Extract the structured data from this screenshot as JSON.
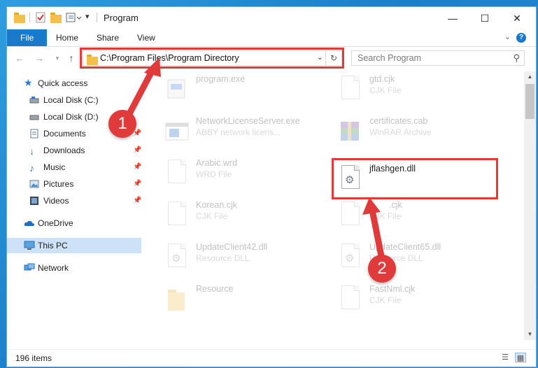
{
  "window": {
    "title": "Program",
    "controls": {
      "minimize": "—",
      "maximize": "☐",
      "close": "✕"
    }
  },
  "ribbon": {
    "tabs": [
      {
        "label": "File"
      },
      {
        "label": "Home"
      },
      {
        "label": "Share"
      },
      {
        "label": "View"
      }
    ],
    "help": "?"
  },
  "navigation": {
    "address": "C:\\Program Files\\Program Directory",
    "search_placeholder": "Search Program"
  },
  "sidebar": {
    "items": [
      {
        "label": "Quick access",
        "icon": "star-icon",
        "pinned": false
      },
      {
        "label": "Local Disk (C:)",
        "icon": "drive-icon",
        "pinned": true
      },
      {
        "label": "Local Disk (D:)",
        "icon": "drive-icon",
        "pinned": true
      },
      {
        "label": "Documents",
        "icon": "documents-icon",
        "pinned": true
      },
      {
        "label": "Downloads",
        "icon": "download-icon",
        "pinned": true
      },
      {
        "label": "Music",
        "icon": "music-icon",
        "pinned": true
      },
      {
        "label": "Pictures",
        "icon": "pictures-icon",
        "pinned": true
      },
      {
        "label": "Videos",
        "icon": "video-icon",
        "pinned": true
      },
      {
        "label": "OneDrive",
        "icon": "cloud-icon",
        "pinned": false
      },
      {
        "label": "This PC",
        "icon": "pc-icon",
        "pinned": false,
        "selected": true
      },
      {
        "label": "Network",
        "icon": "network-icon",
        "pinned": false
      }
    ]
  },
  "files": {
    "left_column": [
      {
        "name": "program.exe",
        "type": "",
        "icon": "exe-icon"
      },
      {
        "name": "NetworkLicenseServer.exe",
        "type": "ABBY network licens...",
        "icon": "app-window-icon"
      },
      {
        "name": "Arabic.wrd",
        "type": "WRD File",
        "icon": "document-icon"
      },
      {
        "name": "Korean.cjk",
        "type": "CJK File",
        "icon": "document-icon"
      },
      {
        "name": "UpdateClient42.dll",
        "type": "Resource DLL",
        "icon": "dll-gear-icon"
      },
      {
        "name": "Resource",
        "type": "",
        "icon": "folder-icon"
      }
    ],
    "right_column": [
      {
        "name": "gtd.cjk",
        "type": "CJK File",
        "icon": "document-icon",
        "faded": true
      },
      {
        "name": "certificates.cab",
        "type": "WinRAR Archive",
        "icon": "winrar-icon",
        "faded": true
      },
      {
        "name": "jflashgen.dll",
        "type": "",
        "icon": "dll-gear-icon",
        "faded": false
      },
      {
        "name": ".cjk",
        "type": "CJK File",
        "icon": "document-icon",
        "faded": true
      },
      {
        "name": "UpdateClient65.dll",
        "type": "Resource DLL",
        "icon": "dll-gear-icon",
        "faded": true
      },
      {
        "name": "FastNml.cjk",
        "type": "CJK File",
        "icon": "document-icon",
        "faded": true
      }
    ]
  },
  "status": {
    "item_count": "196 items"
  },
  "annotations": {
    "step1": "1",
    "step2": "2",
    "highlight_color": "#e03a3a"
  }
}
